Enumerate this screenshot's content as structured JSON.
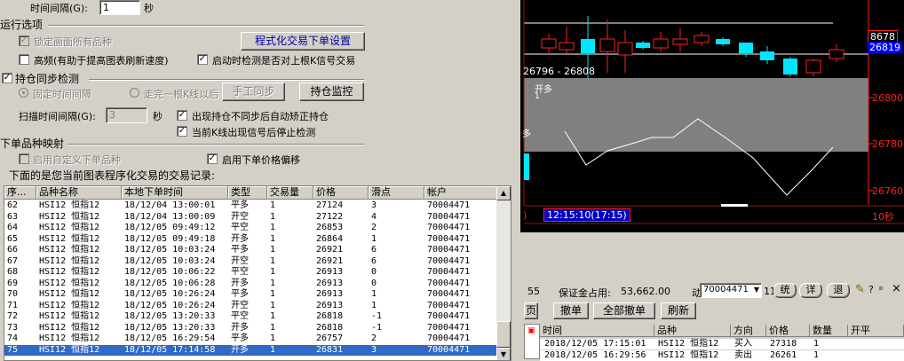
{
  "dialog": {
    "interval_label": "时间间隔(G):",
    "interval_value": "1",
    "interval_unit": "秒",
    "run_options_title": "运行选项",
    "lock_all_label": "锁定画面所有品种",
    "program_trade_button": "程式化交易下单设置",
    "high_freq_label": "高频(有助于提高图表刷新速度)",
    "startup_check_label": "启动时检测是否对上根K信号交易",
    "position_sync_title": "持仓同步检测",
    "fixed_interval_label": "固定时间间隔",
    "after_bar_label": "走完一根K线以后",
    "manual_sync_button": "手工同步",
    "position_monitor_button": "持仓监控",
    "scan_interval_label": "扫描时间间隔(G):",
    "scan_interval_value": "3",
    "scan_interval_unit": "秒",
    "auto_fix_label": "出现持仓不同步后自动矫正持仓",
    "stop_check_label": "当前K线出现信号后停止检测",
    "order_mapping_title": "下单品种映射",
    "custom_product_label": "启用自定义下单品种",
    "price_offset_label": "启用下单价格偏移",
    "records_caption": "下面的是您当前图表程序化交易的交易记录:"
  },
  "table": {
    "columns": [
      "序...",
      "品种名称",
      "本地下单时间",
      "类型",
      "交易量",
      "价格",
      "滑点",
      "帐户"
    ],
    "rows": [
      [
        "62",
        "HSI12 恒指12",
        "18/12/04 13:00:01",
        "平多",
        "1",
        "27124",
        "3",
        "70004471"
      ],
      [
        "63",
        "HSI12 恒指12",
        "18/12/04 13:00:09",
        "开空",
        "1",
        "27122",
        "4",
        "70004471"
      ],
      [
        "64",
        "HSI12 恒指12",
        "18/12/05 09:49:12",
        "平空",
        "1",
        "26853",
        "2",
        "70004471"
      ],
      [
        "65",
        "HSI12 恒指12",
        "18/12/05 09:49:18",
        "开多",
        "1",
        "26864",
        "1",
        "70004471"
      ],
      [
        "66",
        "HSI12 恒指12",
        "18/12/05 10:03:24",
        "平多",
        "1",
        "26921",
        "6",
        "70004471"
      ],
      [
        "67",
        "HSI12 恒指12",
        "18/12/05 10:03:24",
        "开空",
        "1",
        "26921",
        "6",
        "70004471"
      ],
      [
        "68",
        "HSI12 恒指12",
        "18/12/05 10:06:22",
        "平空",
        "1",
        "26913",
        "0",
        "70004471"
      ],
      [
        "69",
        "HSI12 恒指12",
        "18/12/05 10:06:28",
        "开多",
        "1",
        "26913",
        "0",
        "70004471"
      ],
      [
        "70",
        "HSI12 恒指12",
        "18/12/05 10:26:24",
        "平多",
        "1",
        "26913",
        "1",
        "70004471"
      ],
      [
        "71",
        "HSI12 恒指12",
        "18/12/05 10:26:24",
        "开空",
        "1",
        "26913",
        "1",
        "70004471"
      ],
      [
        "72",
        "HSI12 恒指12",
        "18/12/05 13:20:33",
        "平空",
        "1",
        "26818",
        "-1",
        "70004471"
      ],
      [
        "73",
        "HSI12 恒指12",
        "18/12/05 13:20:33",
        "开多",
        "1",
        "26818",
        "-1",
        "70004471"
      ],
      [
        "74",
        "HSI12 恒指12",
        "18/12/05 16:29:54",
        "平多",
        "1",
        "26757",
        "2",
        "70004471"
      ],
      [
        "75",
        "HSI12 恒指12",
        "18/12/05 17:14:58",
        "开多",
        "1",
        "26831",
        "3",
        "70004471"
      ]
    ]
  },
  "chart": {
    "range_text": "26796 - 26808",
    "signal_label": "开多",
    "signal_count": "1",
    "left_label": "多",
    "price_tag_1": "8678",
    "price_tag_2": "26819",
    "axis_1": "26800",
    "axis_2": "26780",
    "axis_3": "26760",
    "time_text": "12:15:10(17:15)",
    "interval_text": "10秒"
  },
  "account_bar": {
    "count": "55",
    "margin_label": "保证金占用:",
    "margin_value": "53,662.00",
    "account_prefix": "动",
    "account_value": "70004471",
    "suffix_num": "11",
    "btn_stat": "统",
    "btn_detail": "详",
    "btn_exit": "退"
  },
  "order_toolbar": {
    "partial": "页",
    "cancel": "撤单",
    "cancel_all": "全部撤单",
    "refresh": "刷新"
  },
  "orders": {
    "columns": [
      "时间",
      "品种",
      "方向",
      "价格",
      "数量",
      "开平"
    ],
    "rows": [
      [
        "2018/12/05 17:15:01",
        "HSI12 恒指12",
        "买入",
        "27318",
        "1",
        ""
      ],
      [
        "2018/12/05 16:29:56",
        "HSI12 恒指12",
        "卖出",
        "26261",
        "1",
        ""
      ]
    ]
  },
  "colors": {
    "up": "#ff2020",
    "down": "#00e6ff",
    "band": "#808080",
    "line": "#ffffff",
    "selection": "#3169c6"
  }
}
